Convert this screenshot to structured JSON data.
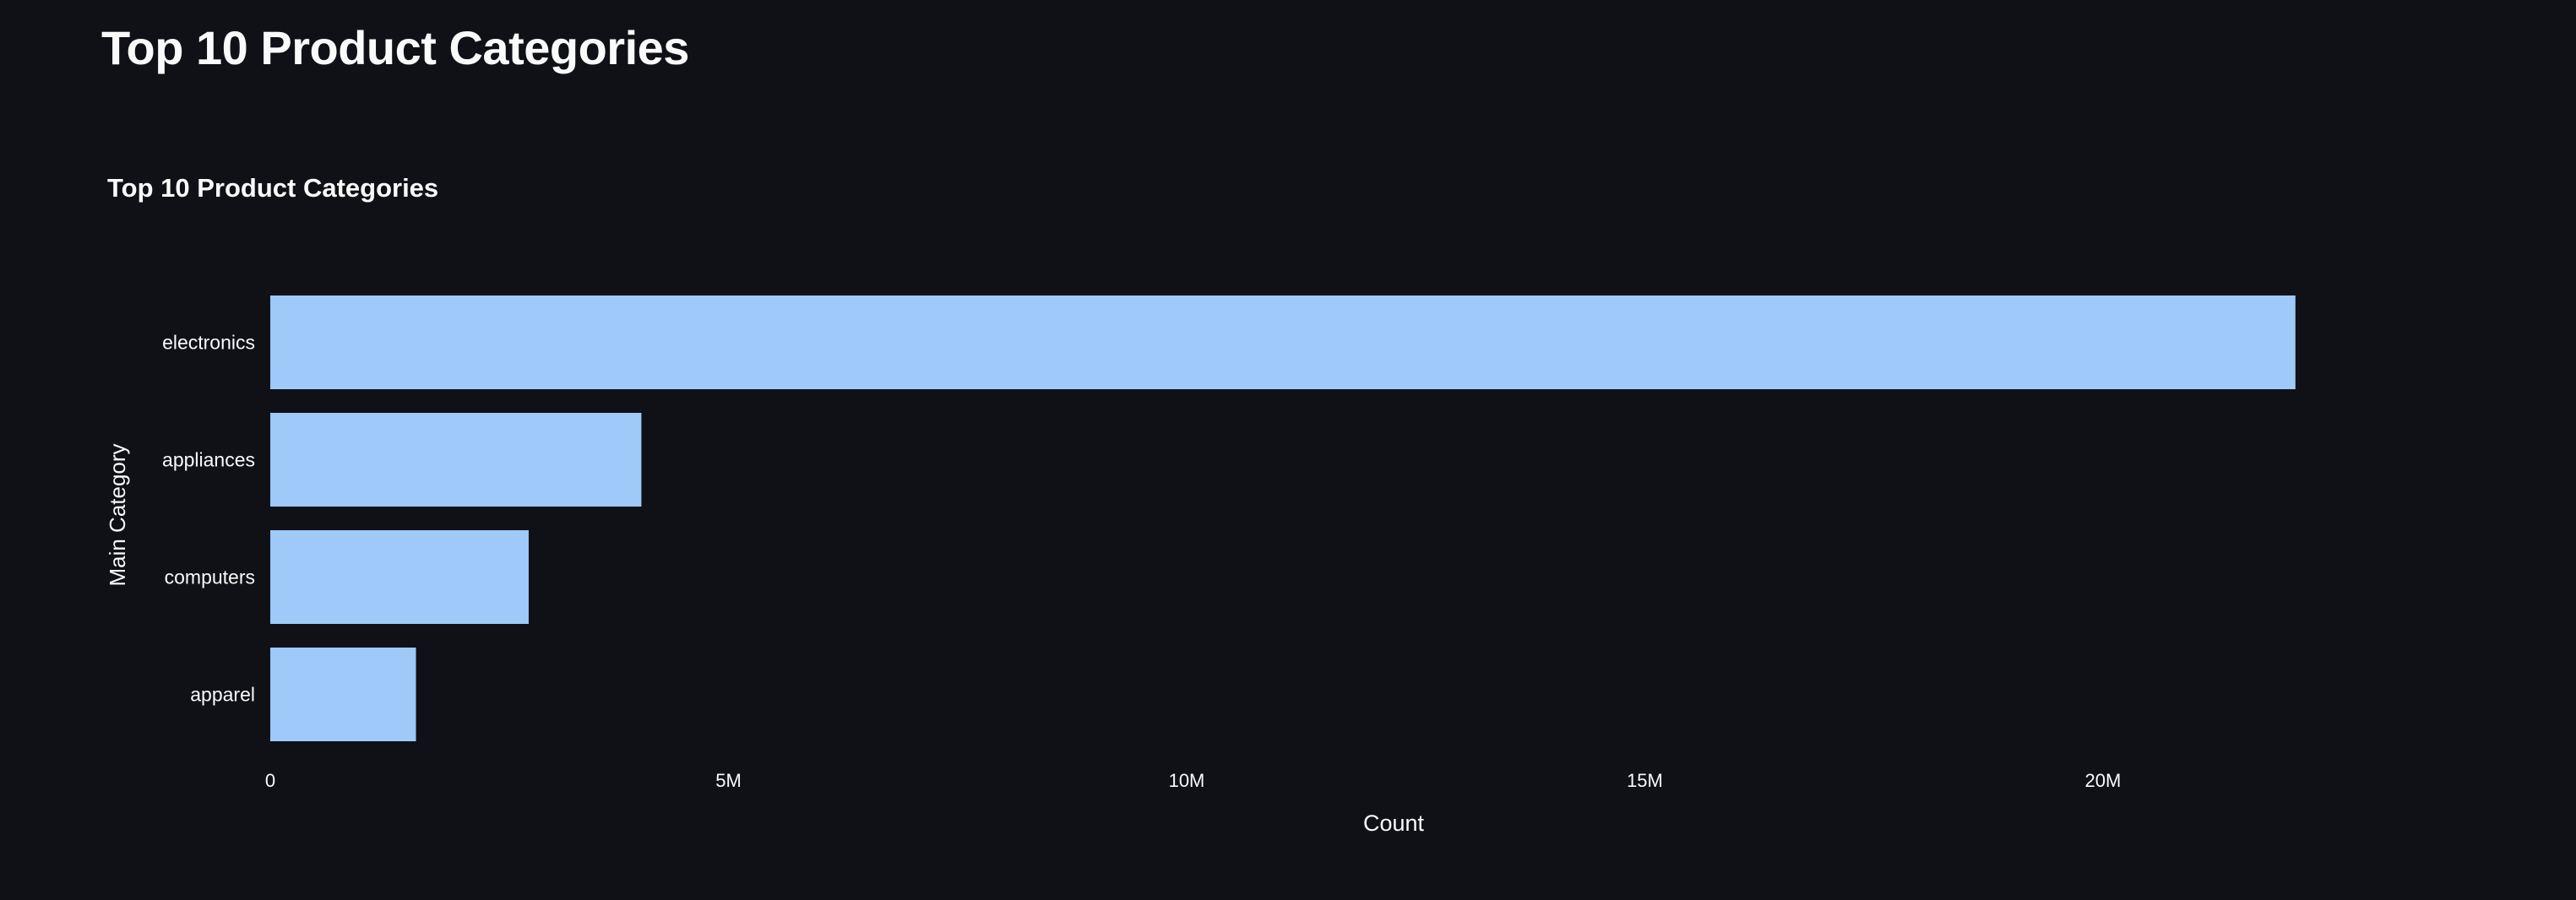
{
  "page": {
    "title": "Top 10 Product Categories"
  },
  "colors": {
    "background": "#0f1117",
    "bar": "#9ec9f9",
    "text": "#fafafa"
  },
  "chart_data": {
    "type": "bar",
    "orientation": "horizontal",
    "title": "Top 10 Product Categories",
    "xlabel": "Count",
    "ylabel": "Main Category",
    "categories": [
      "electronics",
      "appliances",
      "computers",
      "apparel"
    ],
    "values": [
      22100000,
      4050000,
      2820000,
      1590000
    ],
    "xlim": [
      0,
      23300000
    ],
    "xticks": [
      {
        "value": 0,
        "label": "0"
      },
      {
        "value": 5000000,
        "label": "5M"
      },
      {
        "value": 10000000,
        "label": "10M"
      },
      {
        "value": 15000000,
        "label": "15M"
      },
      {
        "value": 20000000,
        "label": "20M"
      }
    ],
    "grid": false,
    "legend": "none"
  }
}
